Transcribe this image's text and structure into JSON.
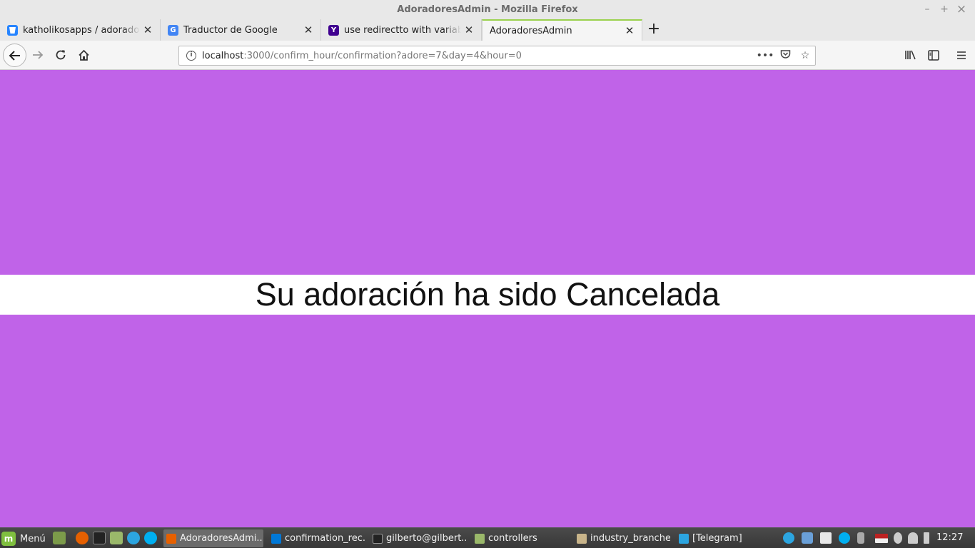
{
  "window": {
    "title": "AdoradoresAdmin - Mozilla Firefox",
    "controls": {
      "minimize": "–",
      "maximize": "+",
      "close": "×"
    }
  },
  "tabs": [
    {
      "label": "katholikosapps / adoradores-admin",
      "icon": "bitbucket-icon",
      "color": "#2684ff"
    },
    {
      "label": "Traductor de Google",
      "icon": "google-translate-icon",
      "color": "#4285f4"
    },
    {
      "label": "use redirectto with variable rails",
      "icon": "yahoo-icon",
      "color": "#400090"
    },
    {
      "label": "AdoradoresAdmin",
      "icon": "",
      "color": ""
    }
  ],
  "newtab_label": "+",
  "navbar": {
    "url_host": "localhost",
    "url_rest": ":3000/confirm_hour/confirmation?adore=7&day=4&hour=0"
  },
  "page": {
    "message": "Su adoración ha sido Cancelada",
    "background": "#c063e8"
  },
  "taskbar": {
    "menu_label": "Menú",
    "tasks": [
      {
        "label": "AdoradoresAdmi...",
        "active": true,
        "color": "#e66000"
      },
      {
        "label": "confirmation_rec...",
        "active": false,
        "color": "#0078d7"
      },
      {
        "label": "gilberto@gilbert...",
        "active": false,
        "color": "#222222"
      },
      {
        "label": "controllers",
        "active": false,
        "color": "#9ab86a"
      },
      {
        "label": "industry_branche...",
        "active": false,
        "color": "#c8b48a"
      },
      {
        "label": "[Telegram]",
        "active": false,
        "color": "#2ca5e0"
      }
    ],
    "clock": "12:27"
  }
}
